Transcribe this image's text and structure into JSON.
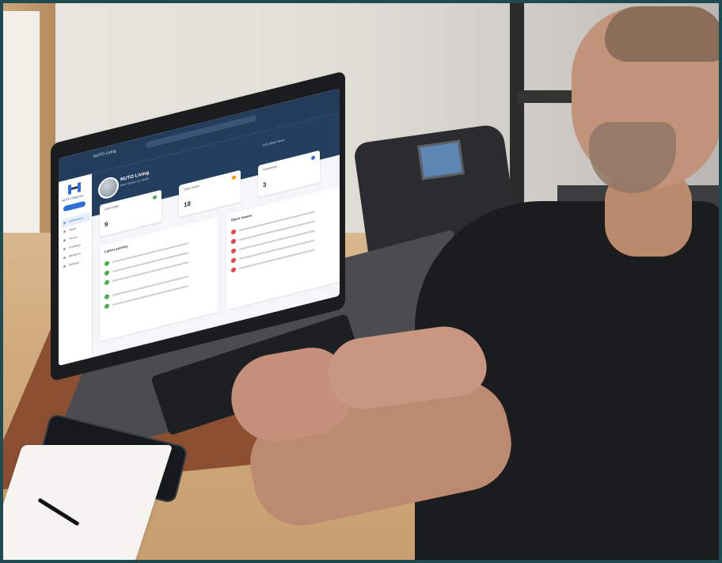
{
  "screen_ui": {
    "topbar": {
      "project": "NUTO Living"
    },
    "sidebar": {
      "logo_text": "NUTO Platform",
      "items": [
        {
          "label": "Dashboard",
          "active": true
        },
        {
          "label": "Tasks",
          "active": false
        },
        {
          "label": "Issues",
          "active": false
        },
        {
          "label": "Drawings",
          "active": false
        },
        {
          "label": "Members",
          "active": false
        },
        {
          "label": "Settings",
          "active": false
        }
      ]
    },
    "header": {
      "project_name": "NUTO Living",
      "subtitle": "Main Street 12, Berlin",
      "actions": "Edit   Share   More"
    },
    "stats": [
      {
        "label": "Open tasks",
        "value": "9",
        "dot_color": "#4caf50"
      },
      {
        "label": "Open issues",
        "value": "18",
        "dot_color": "#ff9800"
      },
      {
        "label": "Documents",
        "value": "3",
        "dot_color": "#2f6fd6"
      }
    ],
    "panels": {
      "left_title": "Latest activity",
      "right_title": "Open issues"
    }
  },
  "colors": {
    "topbar": "#223c5a",
    "accent": "#2f6fd6",
    "success": "#4caf50",
    "danger": "#e5484d",
    "frame": "#1f4a52"
  }
}
